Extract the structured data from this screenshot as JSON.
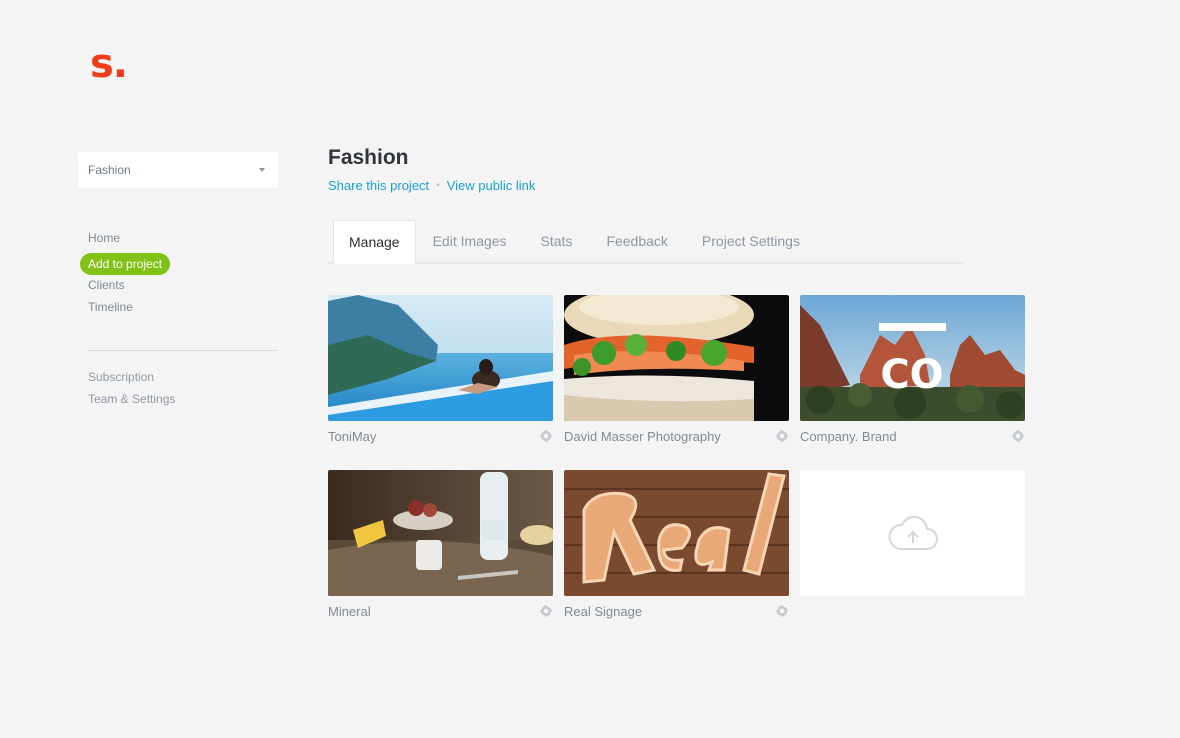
{
  "brand": {
    "logo_text": "s.",
    "accent": "#ef3d1b"
  },
  "project_select": {
    "value": "Fashion"
  },
  "sidebar": {
    "primary": [
      {
        "label": "Home"
      },
      {
        "label": "Add to project",
        "highlight_color": "#82c218"
      },
      {
        "label": "Clients"
      },
      {
        "label": "Timeline"
      }
    ],
    "secondary": [
      {
        "label": "Subscription"
      },
      {
        "label": "Team & Settings"
      }
    ]
  },
  "project": {
    "title": "Fashion",
    "share_link": "Share this project",
    "public_link": "View public link",
    "link_color": "#1a9fd6"
  },
  "tabs": [
    {
      "label": "Manage",
      "active": true
    },
    {
      "label": "Edit Images"
    },
    {
      "label": "Stats"
    },
    {
      "label": "Feedback"
    },
    {
      "label": "Project Settings"
    }
  ],
  "projects": [
    {
      "name": "ToniMay",
      "thumbnail": "infinity-pool-ocean"
    },
    {
      "name": "David Masser Photography",
      "thumbnail": "sandwich-closeup"
    },
    {
      "name": "Company. Brand",
      "thumbnail": "red-rocks-co-logo",
      "overlay_text": "CO"
    },
    {
      "name": "Mineral",
      "thumbnail": "rustic-table-bottle"
    },
    {
      "name": "Real Signage",
      "thumbnail": "marquee-lights-sign"
    }
  ],
  "upload_tile": {
    "icon": "cloud-upload-icon"
  }
}
